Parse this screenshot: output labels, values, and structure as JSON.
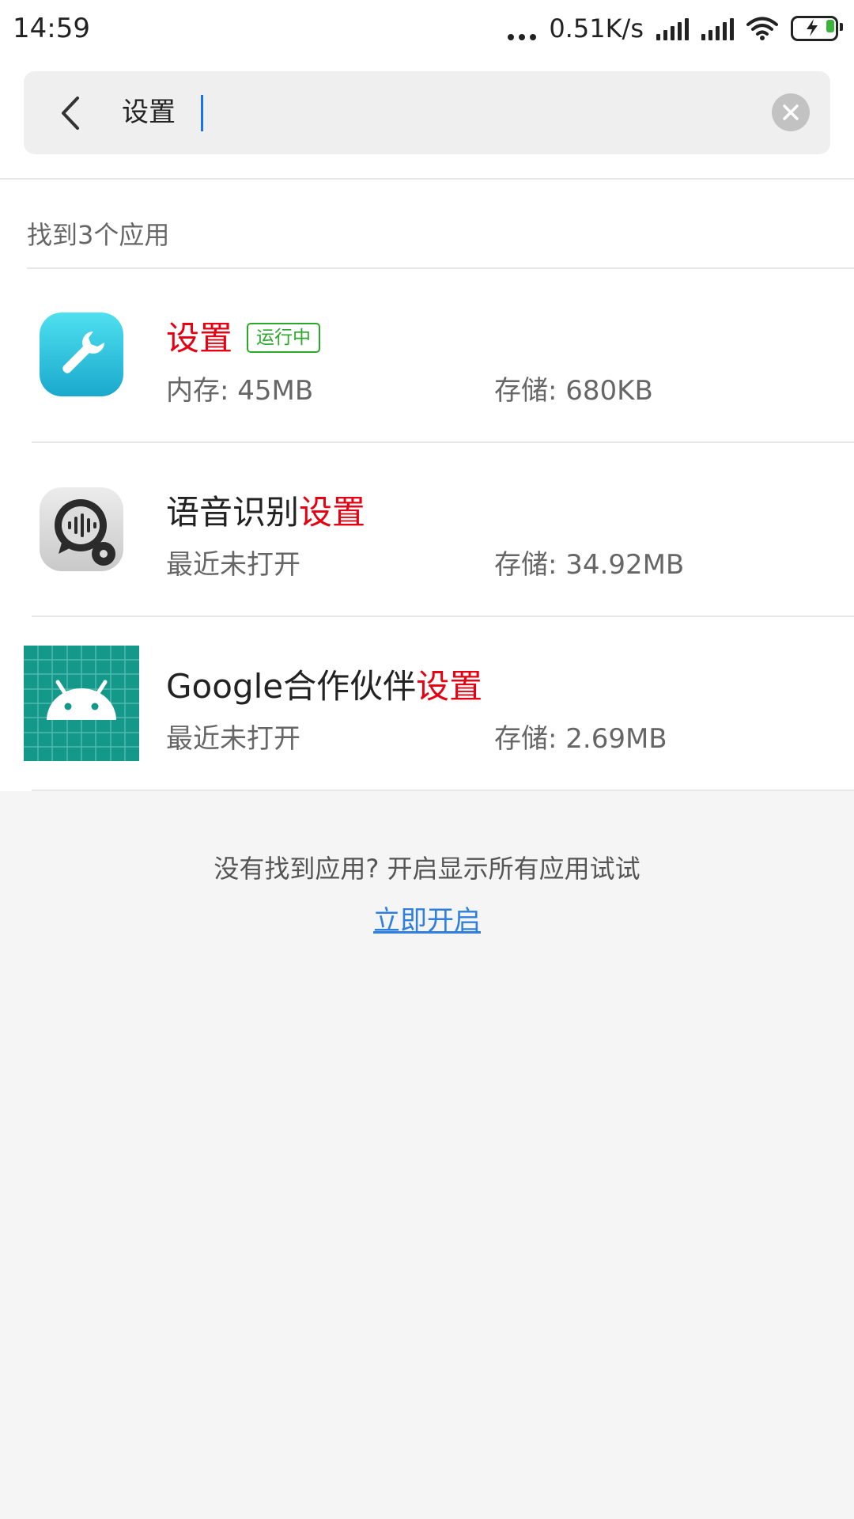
{
  "status_bar": {
    "time": "14:59",
    "speed": "0.51K/s",
    "icons": [
      "more-dots-icon",
      "signal-icon",
      "signal-icon",
      "wifi-icon",
      "battery-charging-icon"
    ]
  },
  "search": {
    "query": "设置",
    "back_icon": "chevron-left-icon",
    "clear_icon": "clear-icon"
  },
  "results_summary": "找到3个应用",
  "results": [
    {
      "name_prefix": "",
      "name_match": "设置",
      "badge": "运行中",
      "left_meta": "内存: 45MB",
      "right_meta": "存储: 680KB",
      "icon": "settings-wrench-icon"
    },
    {
      "name_prefix": "语音识别",
      "name_match": "设置",
      "badge": "",
      "left_meta": "最近未打开",
      "right_meta": "存储: 34.92MB",
      "icon": "voice-recognition-settings-icon"
    },
    {
      "name_prefix": "Google合作伙伴",
      "name_match": "设置",
      "badge": "",
      "left_meta": "最近未打开",
      "right_meta": "存储: 2.69MB",
      "icon": "android-icon"
    }
  ],
  "footer": {
    "message": "没有找到应用? 开启显示所有应用试试",
    "link": "立即开启"
  },
  "colors": {
    "highlight": "#e60012",
    "badge": "#2aa82a",
    "link": "#2f7fde"
  }
}
